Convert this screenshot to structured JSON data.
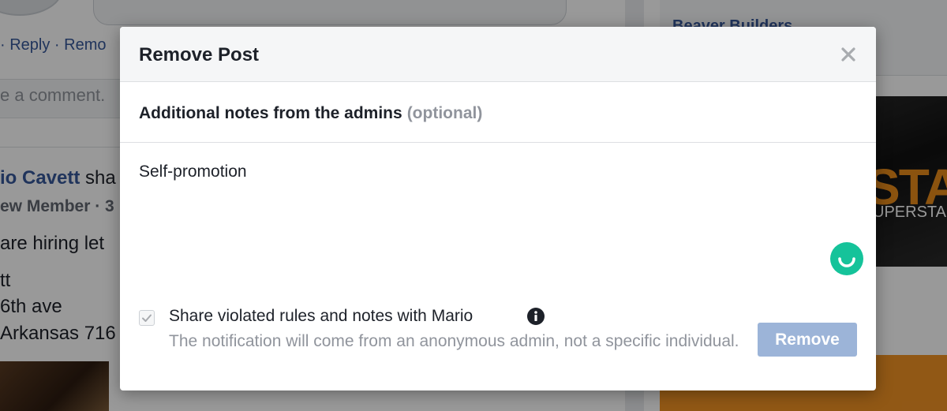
{
  "background": {
    "reply_row": "· Reply · Remo",
    "comment_placeholder": "e a comment.",
    "author_name": "io Cavett",
    "author_action": " sha",
    "member_meta": "ew Member · 3",
    "post_lines": [
      "are hiring let",
      "tt",
      "6th ave",
      "Arkansas 716"
    ],
    "right_link": "Beaver Builders",
    "ad_title": "STAR",
    "ad_subtitle": "UPERSTARS"
  },
  "dialog": {
    "title": "Remove Post",
    "close_icon": "close-icon",
    "notes_label": "Additional notes from the admins",
    "notes_optional": "(optional)",
    "notes_value": "Self-promotion",
    "grammar_icon": "grammarly-icon",
    "share": {
      "checked": true,
      "label": "Share violated rules and notes with Mario",
      "info_icon": "info-icon",
      "description": "The notification will come from an anonymous admin, not a specific individual."
    },
    "remove_label": "Remove"
  },
  "colors": {
    "link_blue": "#365899",
    "button_disabled_blue": "#9cb4d8",
    "grammarly_green": "#15c39a",
    "muted_text": "#90949c"
  }
}
